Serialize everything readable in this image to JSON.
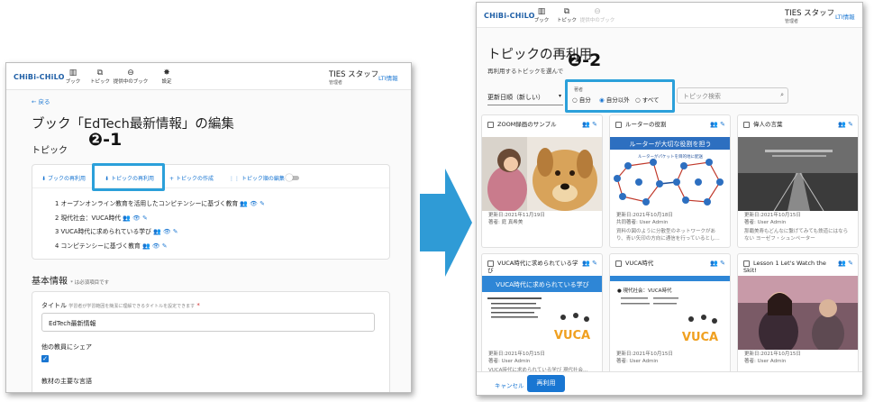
{
  "app": {
    "logo": "CHiBi-CHiLO",
    "nav": [
      {
        "label": "ブック",
        "icon": "book-icon",
        "glyph": "▥"
      },
      {
        "label": "トピック",
        "icon": "topic-icon",
        "glyph": "⧉"
      },
      {
        "label": "提供中のブック",
        "icon": "link-icon",
        "glyph": "⊖"
      },
      {
        "label": "設定",
        "icon": "gear-icon",
        "glyph": "✸"
      }
    ],
    "user_name": "TIES スタッフ",
    "user_role": "管理者",
    "lti": "LTI情報"
  },
  "left": {
    "back": "戻る",
    "title": "ブック「EdTech最新情報」の編集",
    "topic_section": "トピック",
    "toolbar": {
      "reuse_book": "ブックの再利用",
      "reuse_topic": "トピックの再利用",
      "create_topic": "トピックの作成",
      "edit_order": "トピック順の編集"
    },
    "topics": [
      "1 オープンオンライン教育を活用したコンピテンシーに基づく教育",
      "2 現代社会：VUCA時代",
      "3 VUCA時代に求められている学び",
      "4 コンピテンシーに基づく教育"
    ],
    "basic_section": "基本情報",
    "required_note": "* は必須項目です",
    "title_label": "タイトル",
    "title_hint": "学習者が学習範囲を簡潔に理解できるタイトルを設定できます",
    "title_value": "EdTech最新情報",
    "share_label": "他の教員にシェア",
    "language_label": "教材の主要な言語"
  },
  "right": {
    "page_title": "トピックの再利用",
    "subtitle": "再利用するトピックを選んで",
    "sort_label": "更新日順（新しい）",
    "filter_label": "著者",
    "filter_options": [
      "自分",
      "自分以外",
      "すべて"
    ],
    "filter_selected": "自分以外",
    "search_placeholder": "トピック検索",
    "cards": [
      {
        "title": "ZOOM録画のサンプル",
        "date": "更新日:2021年11月19日",
        "author": "著者: 庭 真希美",
        "desc": ""
      },
      {
        "title": "ルーターの役割",
        "date": "更新日:2021年10月18日",
        "author": "共同著者: User Admin",
        "desc": "資料の図のように分散型のネットワークがあり、青い矢印の方向に通信を行っているとし..."
      },
      {
        "title": "偉人の言葉",
        "date": "更新日:2021年10月15日",
        "author": "著者: User Admin",
        "desc": "那覇美寿もどんなに繋げてみても鉄道にはならない ヨーゼフ・シュンペーター"
      },
      {
        "title": "VUCA時代に求められている学び",
        "date": "更新日:2021年10月15日",
        "author": "著者: User Admin",
        "desc": "VUCA時代に求められている学び 現代社会..."
      },
      {
        "title": "VUCA時代",
        "date": "更新日:2021年10月15日",
        "author": "著者: User Admin",
        "desc": ""
      },
      {
        "title": "Lesson 1 Let's Watch the Skit!",
        "date": "更新日:2021年10月15日",
        "author": "著者: User Admin",
        "desc": ""
      }
    ],
    "router_slide_title": "ルーターが大切な役割を担う",
    "router_slide_sub": "ルーターがパケットを目的地に配送",
    "vuca_slide_title": "VUCA時代に求められている学び",
    "vuca_slide_head": "● 現代社会：VUCA時代",
    "vuca_logo": "VUCA",
    "cancel": "キャンセル",
    "reuse": "再利用"
  },
  "markers": {
    "m1": "❷-1",
    "m2": "❷-2"
  },
  "colors": {
    "accent": "#1976d2",
    "highlight": "#2ba0da",
    "arrow": "#2f9bd6"
  }
}
